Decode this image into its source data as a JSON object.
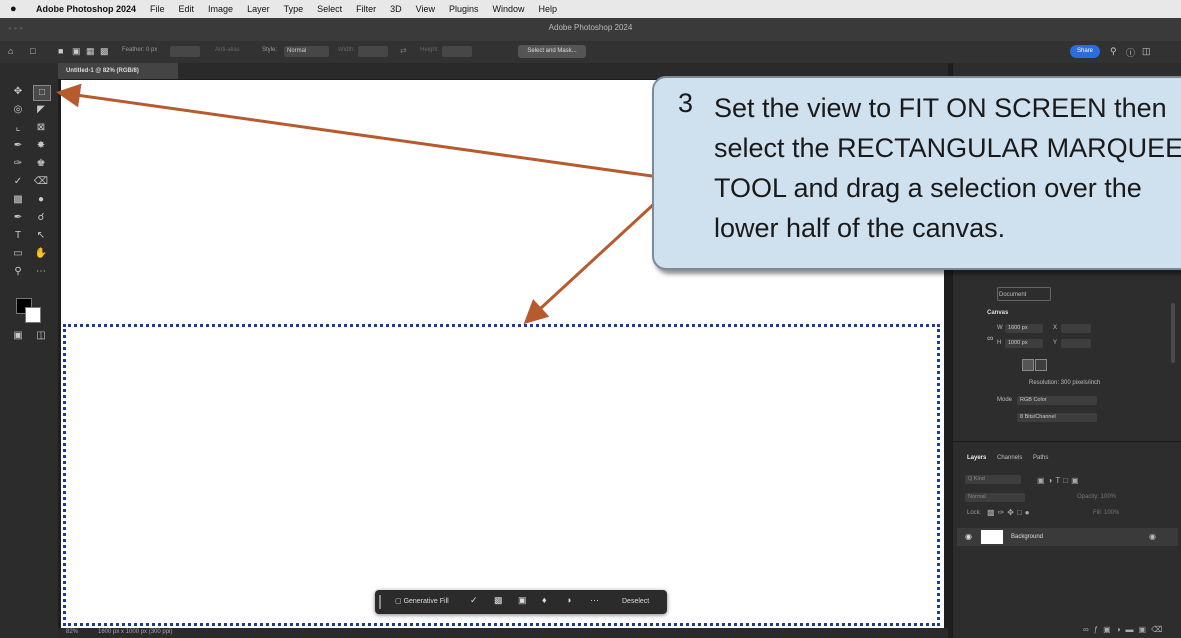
{
  "menubar": {
    "app": "Adobe Photoshop 2024",
    "items": [
      "File",
      "Edit",
      "Image",
      "Layer",
      "Type",
      "Select",
      "Filter",
      "3D",
      "View",
      "Plugins",
      "Window",
      "Help"
    ]
  },
  "titlebar": {
    "title": "Adobe Photoshop 2024"
  },
  "options": {
    "feather": "Feather: 0 px",
    "antialias": "Anti-alias",
    "style_label": "Style:",
    "style_value": "Normal",
    "width_label": "Width:",
    "height_label": "Height:",
    "select_mask": "Select and Mask...",
    "share": "Share"
  },
  "document": {
    "tab": "Untitled-1 @ 82% (RGB/8)",
    "zoom": "82%",
    "status": "1600 px x 1000 px (300 ppi)"
  },
  "properties": {
    "document_label": "Document",
    "canvas_label": "Canvas",
    "w_label": "W",
    "w_value": "1600 px",
    "h_label": "H",
    "h_value": "1000 px",
    "x_label": "X",
    "y_label": "Y",
    "resolution": "Resolution: 300 pixels/inch",
    "mode_label": "Mode",
    "mode_value": "RGB Color",
    "bits_value": "8 Bits/Channel"
  },
  "layers": {
    "tabs": [
      "Layers",
      "Channels",
      "Paths"
    ],
    "kind": "Q Kind",
    "blend": "Normal",
    "opacity": "Opacity: 100%",
    "lock": "Lock:",
    "fill": "Fill: 100%",
    "layer_name": "Background"
  },
  "taskbar": {
    "generative_fill": "Generative Fill",
    "more": "···",
    "deselect": "Deselect"
  },
  "callout": {
    "number": "3",
    "text": "Set the view to FIT ON SCREEN then\nselect the RECTANGULAR MARQUEE\nTOOL and drag a selection over the\nlower half of the canvas."
  },
  "colors": {
    "callout_bg": "#cfe0ee",
    "arrow": "#b75a2e",
    "selection": "#1d3b9c",
    "share": "#2b6ddf"
  }
}
